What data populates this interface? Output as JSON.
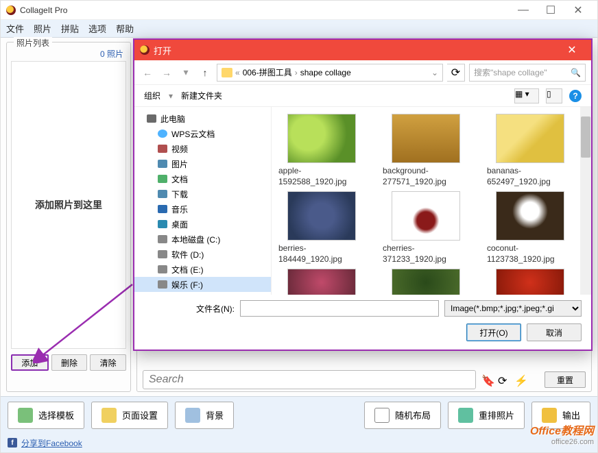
{
  "app": {
    "title": "CollageIt Pro",
    "menu": [
      "文件",
      "照片",
      "拼贴",
      "选项",
      "帮助"
    ]
  },
  "photo_panel": {
    "title": "照片列表",
    "count": "0 照片",
    "placeholder": "添加照片到这里",
    "buttons": {
      "add": "添加",
      "delete": "删除",
      "clear": "清除"
    }
  },
  "search": {
    "placeholder": "Search",
    "reset": "重置"
  },
  "toolbar": {
    "template": "选择模板",
    "page": "页面设置",
    "background": "背景",
    "random": "随机布局",
    "re排": "重排照片",
    "output": "输出"
  },
  "footer": {
    "share": "分享到Facebook"
  },
  "dialog": {
    "title": "打开",
    "path": {
      "seg1": "006-拼图工具",
      "seg2": "shape collage"
    },
    "search_placeholder": "搜索\"shape collage\"",
    "organize": "组织",
    "new_folder": "新建文件夹",
    "tree": [
      {
        "label": "此电脑",
        "cls": "pc",
        "indent": 0
      },
      {
        "label": "WPS云文档",
        "cls": "cloud",
        "indent": 1
      },
      {
        "label": "视频",
        "cls": "video",
        "indent": 1
      },
      {
        "label": "图片",
        "cls": "pic",
        "indent": 1
      },
      {
        "label": "文档",
        "cls": "doc",
        "indent": 1
      },
      {
        "label": "下载",
        "cls": "dl",
        "indent": 1
      },
      {
        "label": "音乐",
        "cls": "music",
        "indent": 1
      },
      {
        "label": "桌面",
        "cls": "desk",
        "indent": 1
      },
      {
        "label": "本地磁盘 (C:)",
        "cls": "disk",
        "indent": 1
      },
      {
        "label": "软件 (D:)",
        "cls": "disk",
        "indent": 1
      },
      {
        "label": "文档 (E:)",
        "cls": "disk",
        "indent": 1
      },
      {
        "label": "娱乐 (F:)",
        "cls": "disk",
        "indent": 1,
        "selected": true
      }
    ],
    "files": [
      {
        "name": "apple-1592588_1920.jpg",
        "thumb": "apple"
      },
      {
        "name": "background-277571_1920.jpg",
        "thumb": "bg"
      },
      {
        "name": "bananas-652497_1920.jpg",
        "thumb": "banana"
      },
      {
        "name": "berries-184449_1920.jpg",
        "thumb": "berries"
      },
      {
        "name": "cherries-371233_1920.jpg",
        "thumb": "cherries"
      },
      {
        "name": "coconut-1123738_1920.jpg",
        "thumb": "coconut"
      }
    ],
    "filename_label": "文件名(N):",
    "filter": "Image(*.bmp;*.jpg;*.jpeg;*.gi",
    "open_btn": "打开(O)",
    "cancel_btn": "取消"
  },
  "watermark": {
    "line1": "Office教程网",
    "line2": "office26.com"
  }
}
